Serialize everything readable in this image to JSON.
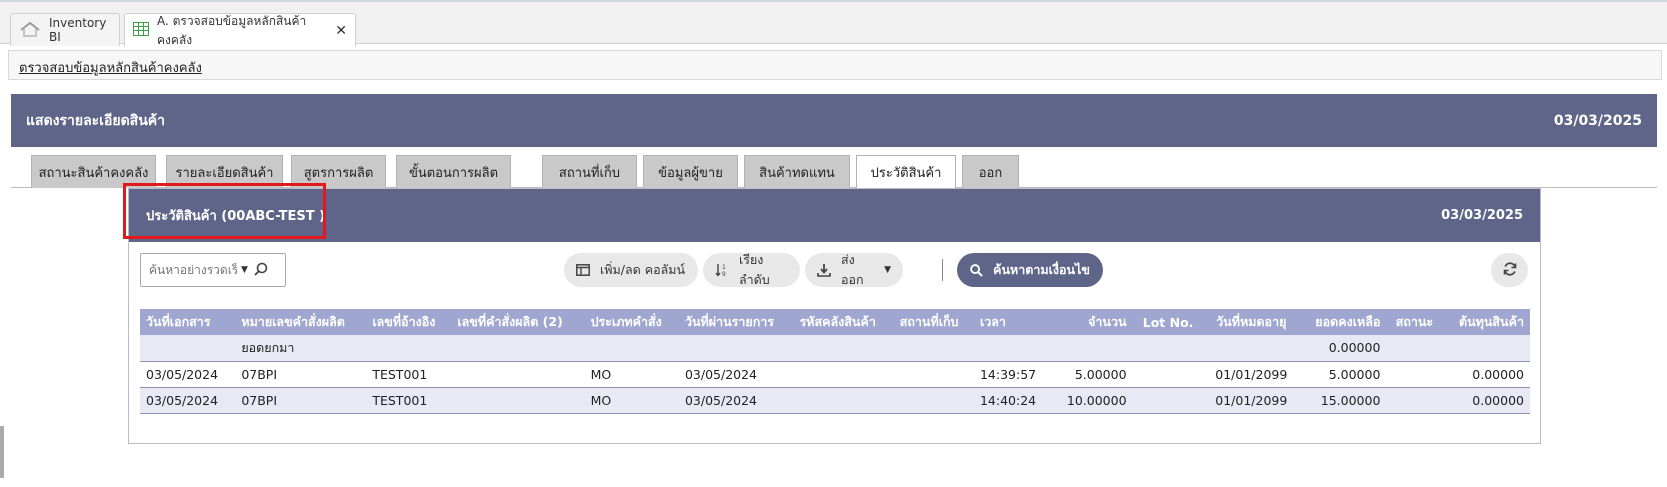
{
  "app_tabs": [
    {
      "label": "Inventory BI",
      "icon": "home-icon"
    },
    {
      "label": "A. ตรวจสอบข้อมูลหลักสินค้าคงคลัง",
      "icon": "spreadsheet-icon",
      "close": "✕"
    }
  ],
  "breadcrumb": "ตรวจสอบข้อมูลหลักสินค้าคงคลัง",
  "header": {
    "title": "แสดงรายละเอียดสินค้า",
    "date": "03/03/2025"
  },
  "tabs": [
    "สถานะสินค้าคงคลัง",
    "รายละเอียดสินค้า",
    "สูตรการผลิต",
    "ขั้นตอนการผลิต",
    "สถานที่เก็บ",
    "ข้อมูลผู้ขาย",
    "สินค้าทดแทน",
    "ประวัติสินค้า",
    "ออก"
  ],
  "active_tab": "ประวัติสินค้า",
  "panel": {
    "title": "ประวัติสินค้า (00ABC-TEST )",
    "date": "03/03/2025"
  },
  "toolbar": {
    "search_placeholder": "ค้นหาอย่างรวดเร็ว",
    "columns_button": "เพิ่ม/ลด คอลัมน์",
    "sort_button": "เรียงลำดับ",
    "export_button": "ส่งออก",
    "advanced_search_button": "ค้นหาตามเงื่อนไข"
  },
  "table": {
    "columns": [
      "วันที่เอกสาร",
      "หมายเลขคำสั่งผลิต",
      "เลขที่อ้างอิง",
      "เลขที่คำสั่งผลิต (2)",
      "ประเภทคำสั่ง",
      "วันที่ผ่านรายการ",
      "รหัสคลังสินค้า",
      "สถานที่เก็บ",
      "เวลา",
      "จำนวน",
      "Lot No.",
      "วันที่หมดอายุ",
      "ยอดคงเหลือ",
      "สถานะ",
      "ต้นทุนสินค้า"
    ],
    "rows": [
      [
        "",
        "ยอดยกมา",
        "",
        "",
        "",
        "",
        "",
        "",
        "",
        "",
        "",
        "",
        "0.00000",
        "",
        ""
      ],
      [
        "03/05/2024",
        "07BPI",
        "TEST001",
        "",
        "MO",
        "03/05/2024",
        "",
        "",
        "14:39:57",
        "5.00000",
        "",
        "01/01/2099",
        "5.00000",
        "",
        "0.00000"
      ],
      [
        "03/05/2024",
        "07BPI",
        "TEST001",
        "",
        "MO",
        "03/05/2024",
        "",
        "",
        "14:40:24",
        "10.00000",
        "",
        "01/01/2099",
        "15.00000",
        "",
        "0.00000"
      ]
    ]
  },
  "colors": {
    "header_bg": "#5f6589",
    "table_header_bg": "#9fa6d0",
    "highlight": "#e0191b"
  }
}
